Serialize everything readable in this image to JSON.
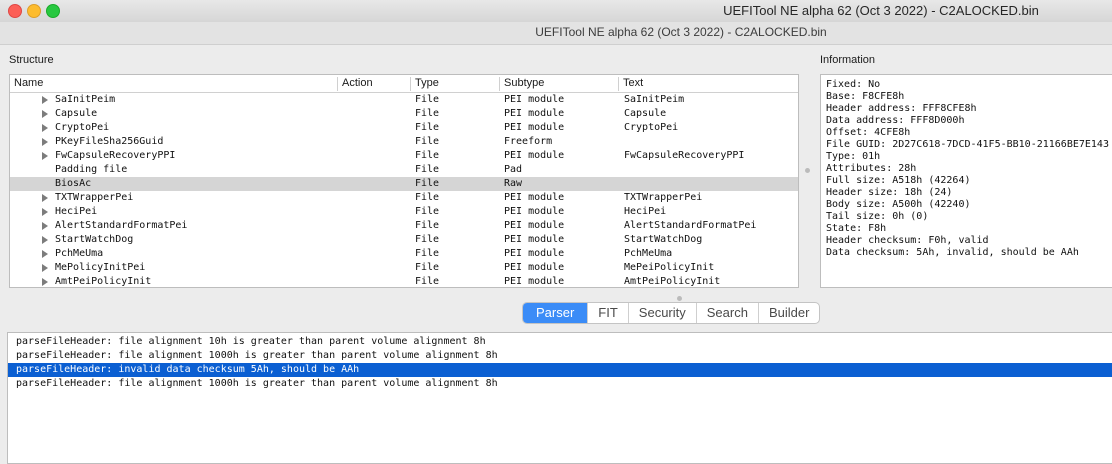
{
  "window": {
    "title": "UEFITool NE alpha 62 (Oct  3 2022) - C2ALOCKED.bin",
    "subtitle": "UEFITool NE alpha 62 (Oct  3 2022) - C2ALOCKED.bin"
  },
  "structure": {
    "label": "Structure",
    "columns": [
      "Name",
      "Action",
      "Type",
      "Subtype",
      "Text"
    ],
    "rows": [
      {
        "name": "SaInitPeim",
        "action": "",
        "type": "File",
        "subtype": "PEI module",
        "text": "SaInitPeim",
        "expandable": true,
        "selected": false
      },
      {
        "name": "Capsule",
        "action": "",
        "type": "File",
        "subtype": "PEI module",
        "text": "Capsule",
        "expandable": true,
        "selected": false
      },
      {
        "name": "CryptoPei",
        "action": "",
        "type": "File",
        "subtype": "PEI module",
        "text": "CryptoPei",
        "expandable": true,
        "selected": false
      },
      {
        "name": "PKeyFileSha256Guid",
        "action": "",
        "type": "File",
        "subtype": "Freeform",
        "text": "",
        "expandable": true,
        "selected": false
      },
      {
        "name": "FwCapsuleRecoveryPPI",
        "action": "",
        "type": "File",
        "subtype": "PEI module",
        "text": "FwCapsuleRecoveryPPI",
        "expandable": true,
        "selected": false
      },
      {
        "name": "Padding file",
        "action": "",
        "type": "File",
        "subtype": "Pad",
        "text": "",
        "expandable": false,
        "selected": false
      },
      {
        "name": "BiosAc",
        "action": "",
        "type": "File",
        "subtype": "Raw",
        "text": "",
        "expandable": false,
        "selected": true
      },
      {
        "name": "TXTWrapperPei",
        "action": "",
        "type": "File",
        "subtype": "PEI module",
        "text": "TXTWrapperPei",
        "expandable": true,
        "selected": false
      },
      {
        "name": "HeciPei",
        "action": "",
        "type": "File",
        "subtype": "PEI module",
        "text": "HeciPei",
        "expandable": true,
        "selected": false
      },
      {
        "name": "AlertStandardFormatPei",
        "action": "",
        "type": "File",
        "subtype": "PEI module",
        "text": "AlertStandardFormatPei",
        "expandable": true,
        "selected": false
      },
      {
        "name": "StartWatchDog",
        "action": "",
        "type": "File",
        "subtype": "PEI module",
        "text": "StartWatchDog",
        "expandable": true,
        "selected": false
      },
      {
        "name": "PchMeUma",
        "action": "",
        "type": "File",
        "subtype": "PEI module",
        "text": "PchMeUma",
        "expandable": true,
        "selected": false
      },
      {
        "name": "MePolicyInitPei",
        "action": "",
        "type": "File",
        "subtype": "PEI module",
        "text": "MePeiPolicyInit",
        "expandable": true,
        "selected": false
      },
      {
        "name": "AmtPeiPolicyInit",
        "action": "",
        "type": "File",
        "subtype": "PEI module",
        "text": "AmtPeiPolicyInit",
        "expandable": true,
        "selected": false
      }
    ]
  },
  "information": {
    "label": "Information",
    "lines": [
      "Fixed: No",
      "Base: F8CFE8h",
      "Header address: FFF8CFE8h",
      "Data address: FFF8D000h",
      "Offset: 4CFE8h",
      "File GUID: 2D27C618-7DCD-41F5-BB10-21166BE7E143",
      "Type: 01h",
      "Attributes: 28h",
      "Full size: A518h (42264)",
      "Header size: 18h (24)",
      "Body size: A500h (42240)",
      "Tail size: 0h (0)",
      "State: F8h",
      "Header checksum: F0h, valid",
      "Data checksum: 5Ah, invalid, should be AAh"
    ]
  },
  "tabs": [
    "Parser",
    "FIT",
    "Security",
    "Search",
    "Builder"
  ],
  "active_tab": "Parser",
  "messages": [
    {
      "text": "parseFileHeader: file alignment 10h is greater than parent volume alignment 8h",
      "selected": false
    },
    {
      "text": "parseFileHeader: file alignment 1000h is greater than parent volume alignment 8h",
      "selected": false
    },
    {
      "text": "parseFileHeader: invalid data checksum 5Ah, should be AAh",
      "selected": true
    },
    {
      "text": "parseFileHeader: file alignment 1000h is greater than parent volume alignment 8h",
      "selected": false
    }
  ],
  "colors": {
    "selection_blue": "#0b5fd2",
    "tab_active": "#3b8cf7",
    "row_selected_gray": "#d5d5d5"
  }
}
